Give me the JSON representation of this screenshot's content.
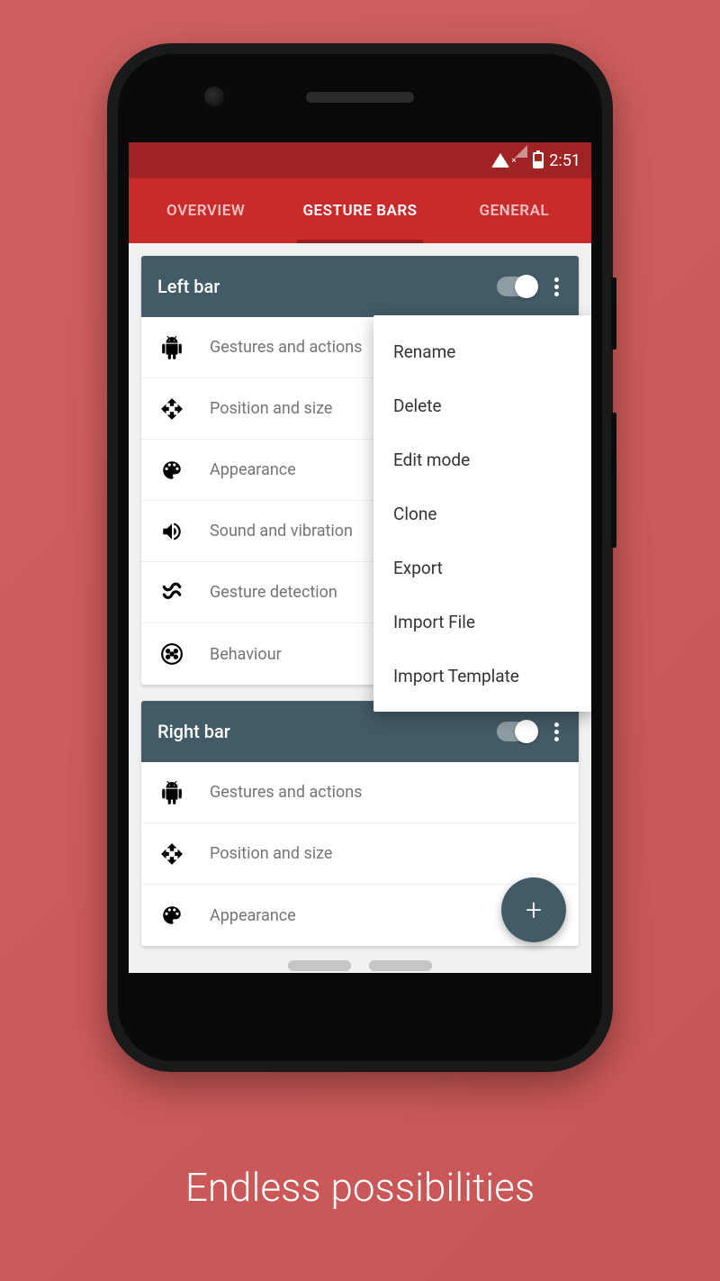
{
  "status": {
    "time": "2:51"
  },
  "tabs": {
    "overview": "OVERVIEW",
    "gesture_bars": "GESTURE BARS",
    "general": "GENERAL"
  },
  "cards": [
    {
      "title": "Left bar",
      "rows": [
        {
          "label": "Gestures and actions",
          "icon": "android-icon"
        },
        {
          "label": "Position and size",
          "icon": "move-icon"
        },
        {
          "label": "Appearance",
          "icon": "palette-icon"
        },
        {
          "label": "Sound and vibration",
          "icon": "sound-icon"
        },
        {
          "label": "Gesture detection",
          "icon": "squiggle-icon"
        },
        {
          "label": "Behaviour",
          "icon": "dots-circle-icon"
        }
      ]
    },
    {
      "title": "Right bar",
      "rows": [
        {
          "label": "Gestures and actions",
          "icon": "android-icon"
        },
        {
          "label": "Position and size",
          "icon": "move-icon"
        },
        {
          "label": "Appearance",
          "icon": "palette-icon"
        }
      ]
    }
  ],
  "popup": {
    "items": [
      "Rename",
      "Delete",
      "Edit mode",
      "Clone",
      "Export",
      "Import File",
      "Import Template"
    ]
  },
  "fab": {
    "label": "+"
  },
  "caption": "Endless possibilities"
}
